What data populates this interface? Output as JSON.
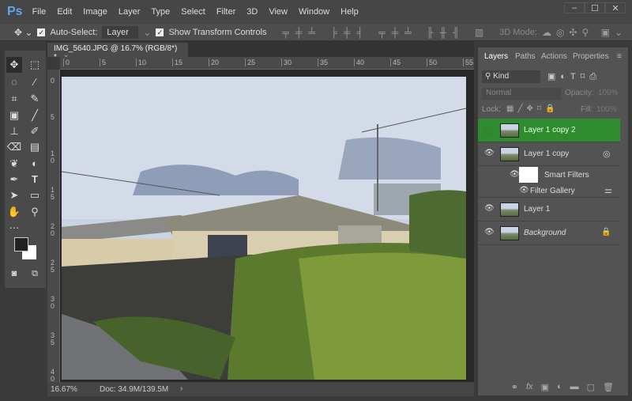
{
  "app": {
    "logo": "Ps"
  },
  "menu": [
    "File",
    "Edit",
    "Image",
    "Layer",
    "Type",
    "Select",
    "Filter",
    "3D",
    "View",
    "Window",
    "Help"
  ],
  "window_controls": [
    "–",
    "☐",
    "✕"
  ],
  "options": {
    "auto_select_label": "Auto-Select:",
    "auto_select_checked": true,
    "auto_select_target": "Layer",
    "show_transform_label": "Show Transform Controls",
    "show_transform_checked": true,
    "mode_3d_label": "3D Mode:"
  },
  "document": {
    "tab_title": "IMG_5640.JPG @ 16.7% (RGB/8*) *",
    "close": "×",
    "zoom": "16.67%",
    "doc_size": "Doc: 34.9M/139.5M",
    "ruler_top": [
      "0",
      "5",
      "10",
      "15",
      "20",
      "25",
      "30",
      "35",
      "40",
      "45",
      "50",
      "55"
    ],
    "ruler_left": [
      "0",
      "5",
      "10",
      "15",
      "20",
      "25",
      "30",
      "35",
      "40"
    ]
  },
  "panel": {
    "tabs": [
      "Layers",
      "Paths",
      "Actions",
      "Properties"
    ],
    "filter_kind": "Kind",
    "blend_mode": "Normal",
    "opacity_label": "Opacity:",
    "opacity": "100%",
    "lock_label": "Lock:",
    "fill_label": "Fill:",
    "fill": "100%",
    "layers": [
      {
        "name": "Layer 1 copy 2",
        "selected": true,
        "visible": false
      },
      {
        "name": "Layer 1 copy",
        "visible": true
      },
      {
        "name": "Smart Filters",
        "visible": true
      },
      {
        "name": "Filter Gallery",
        "visible": true
      },
      {
        "name": "Layer 1",
        "visible": true
      },
      {
        "name": "Background",
        "visible": true,
        "locked": true
      }
    ]
  },
  "colors": {
    "selected_layer": "#2e8b2e",
    "accent": "#5fa7e6"
  }
}
